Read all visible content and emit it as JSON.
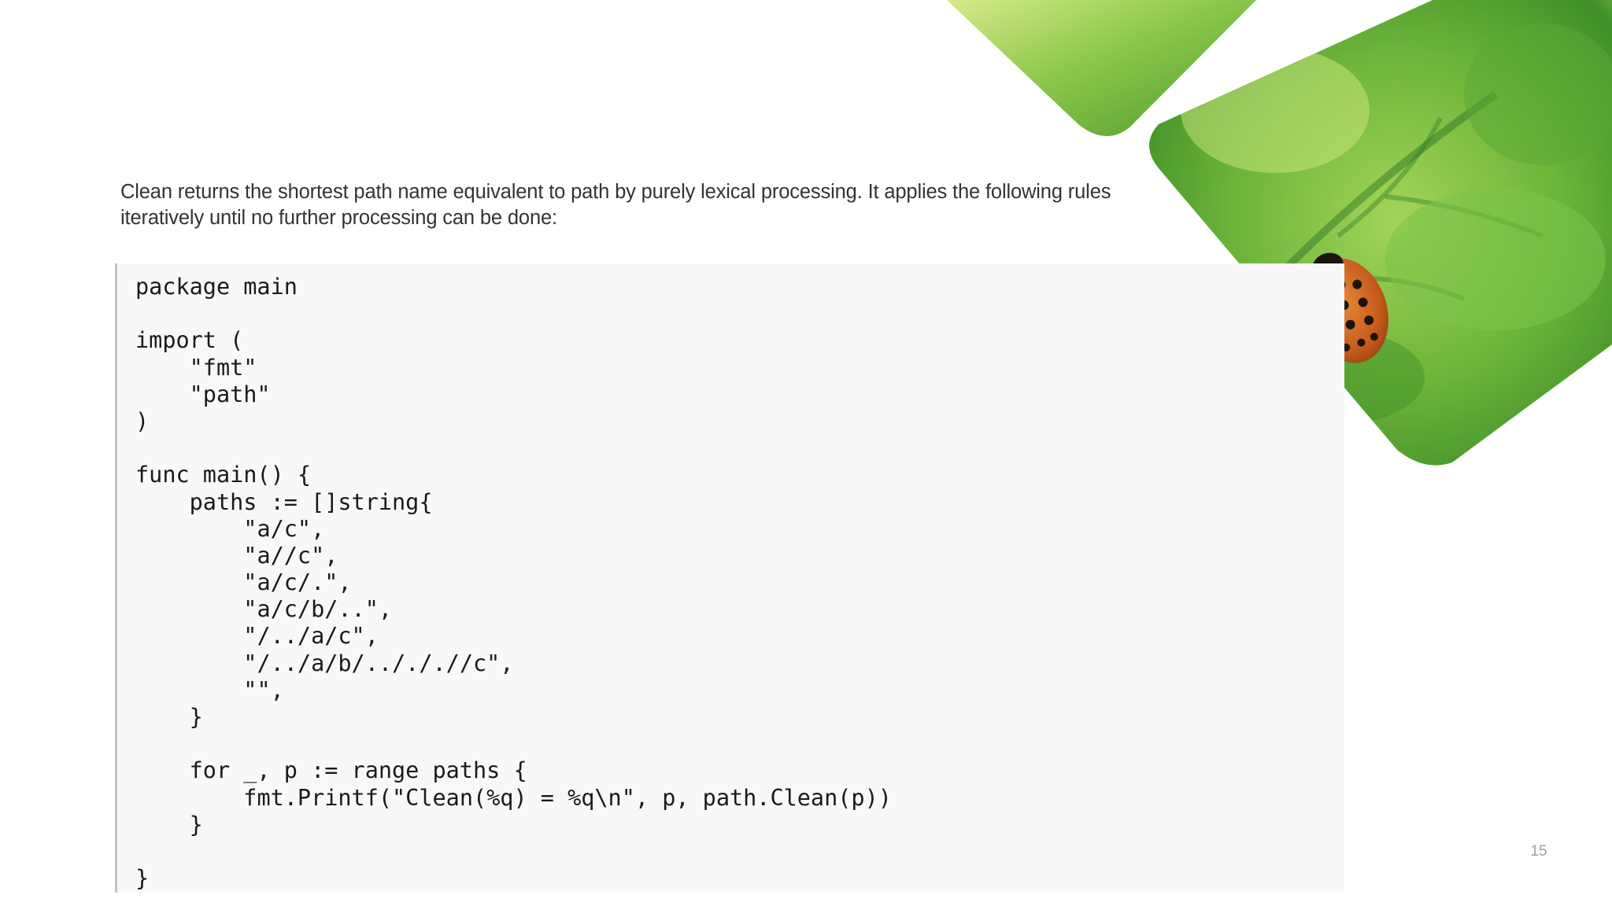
{
  "slide": {
    "description": "Clean returns the shortest path name equivalent to path by purely lexical processing. It applies the following rules iteratively until no further processing can be done:",
    "page_number": "15"
  },
  "code": {
    "language": "go",
    "lines": [
      "package main",
      "",
      "import (",
      "\t\"fmt\"",
      "\t\"path\"",
      ")",
      "",
      "func main() {",
      "\tpaths := []string{",
      "\t\t\"a/c\",",
      "\t\t\"a//c\",",
      "\t\t\"a/c/.\",",
      "\t\t\"a/c/b/..\",",
      "\t\t\"/../a/c\",",
      "\t\t\"/../a/b/../././/c\",",
      "\t\t\"\",",
      "\t}",
      "",
      "\tfor _, p := range paths {",
      "\t\tfmt.Printf(\"Clean(%q) = %q\\n\", p, path.Clean(p))",
      "\t}",
      "",
      "}"
    ]
  },
  "decoration": {
    "image": "leaf-with-beetle-larva",
    "colors": {
      "leaf_light": "#c8e26a",
      "leaf_mid": "#6fb63a",
      "leaf_dark": "#2f7a22",
      "larva_orange": "#c8621e",
      "larva_dark": "#1c1410"
    }
  }
}
